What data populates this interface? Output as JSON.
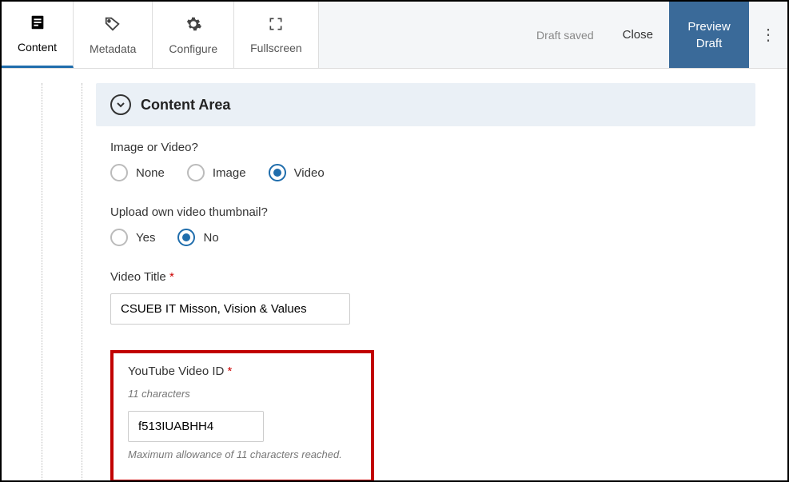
{
  "toolbar": {
    "tabs": {
      "content": "Content",
      "metadata": "Metadata",
      "configure": "Configure",
      "fullscreen": "Fullscreen"
    },
    "draft_saved": "Draft saved",
    "close": "Close",
    "preview_line1": "Preview",
    "preview_line2": "Draft"
  },
  "section": {
    "title": "Content Area"
  },
  "fields": {
    "image_or_video_label": "Image or Video?",
    "none": "None",
    "image": "Image",
    "video": "Video",
    "upload_thumb_label": "Upload own video thumbnail?",
    "yes": "Yes",
    "no": "No",
    "video_title_label": "Video Title ",
    "video_title_value": "CSUEB IT Misson, Vision & Values",
    "youtube_id_label": "YouTube Video ID ",
    "youtube_id_hint": "11 characters",
    "youtube_id_value": "f513IUABHH4",
    "youtube_id_max": "Maximum allowance of 11 characters reached."
  }
}
